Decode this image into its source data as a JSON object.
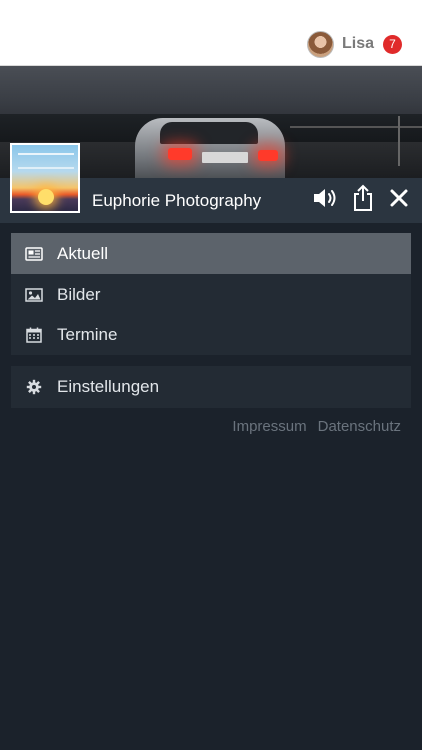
{
  "header": {
    "user_name": "Lisa",
    "notification_count": "7"
  },
  "channel": {
    "title": "Euphorie Photography"
  },
  "menu": {
    "items": [
      {
        "label": "Aktuell",
        "icon": "newspaper-icon",
        "active": true
      },
      {
        "label": "Bilder",
        "icon": "image-icon",
        "active": false
      },
      {
        "label": "Termine",
        "icon": "calendar-icon",
        "active": false
      }
    ],
    "settings_label": "Einstellungen"
  },
  "footer": {
    "imprint_label": "Impressum",
    "privacy_label": "Datenschutz"
  },
  "colors": {
    "background": "#1b222b",
    "titlebar": "#2b3540",
    "menu_panel": "#232b34",
    "active_item": "#5c636b",
    "badge": "#e02a2a"
  }
}
